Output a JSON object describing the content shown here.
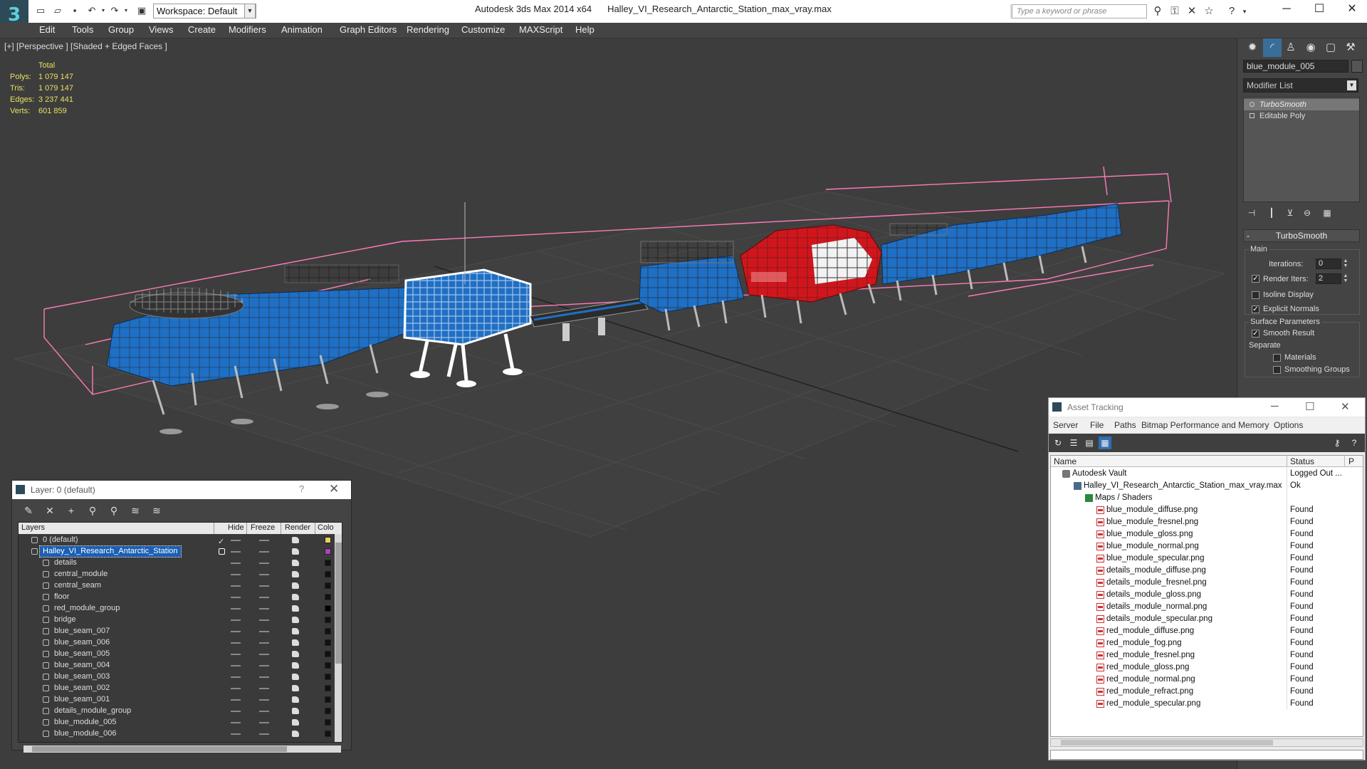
{
  "window": {
    "app_title": "Autodesk 3ds Max  2014 x64",
    "doc_title": "Halley_VI_Research_Antarctic_Station_max_vray.max",
    "workspace": "Workspace: Default",
    "search_placeholder": "Type a keyword or phrase",
    "logo_glyph": "3"
  },
  "menu": [
    "Edit",
    "Tools",
    "Group",
    "Views",
    "Create",
    "Modifiers",
    "Animation",
    "Graph Editors",
    "Rendering",
    "Customize",
    "MAXScript",
    "Help"
  ],
  "viewport": {
    "label": "[+] [Perspective ] [Shaded + Edged Faces ]",
    "stats": {
      "header": "Total",
      "rows": [
        {
          "label": "Polys:",
          "value": "1 079 147"
        },
        {
          "label": "Tris:",
          "value": "1 079 147"
        },
        {
          "label": "Edges:",
          "value": "3 237 441"
        },
        {
          "label": "Verts:",
          "value": "601 859"
        }
      ]
    },
    "colors": {
      "blue": "#1f6fc4",
      "red": "#d0161c",
      "white": "#ffffff",
      "pink": "#ff7ab8",
      "grid": "#4a4a4a"
    }
  },
  "modify_panel": {
    "object_name": "blue_module_005",
    "modifier_list": "Modifier List",
    "stack": [
      "TurboSmooth",
      "Editable Poly"
    ],
    "rollout_title": "TurboSmooth",
    "main_group": "Main",
    "iterations_label": "Iterations:",
    "iterations_value": "0",
    "render_iters_label": "Render Iters:",
    "render_iters_value": "2",
    "isoline_label": "Isoline Display",
    "explicit_label": "Explicit Normals",
    "surface_group": "Surface Parameters",
    "smooth_label": "Smooth Result",
    "separate_label": "Separate",
    "materials_label": "Materials",
    "smoothing_label": "Smoothing Groups"
  },
  "layer_window": {
    "title": "Layer: 0 (default)",
    "help": "?",
    "columns": [
      "Layers",
      "Hide",
      "Freeze",
      "Render",
      "Colo"
    ],
    "rows": [
      {
        "name": "0 (default)",
        "indent": 1,
        "color": "#e8d060",
        "check": "✓"
      },
      {
        "name": "Halley_VI_Research_Antarctic_Station",
        "indent": 1,
        "color": "#b040c0",
        "selected": true
      },
      {
        "name": "details",
        "indent": 2,
        "color": "#111111"
      },
      {
        "name": "central_module",
        "indent": 2,
        "color": "#111111"
      },
      {
        "name": "central_seam",
        "indent": 2,
        "color": "#111111"
      },
      {
        "name": "floor",
        "indent": 2,
        "color": "#111111"
      },
      {
        "name": "red_module_group",
        "indent": 2,
        "color": "#000000"
      },
      {
        "name": "bridge",
        "indent": 2,
        "color": "#111111"
      },
      {
        "name": "blue_seam_007",
        "indent": 2,
        "color": "#111111"
      },
      {
        "name": "blue_seam_006",
        "indent": 2,
        "color": "#111111"
      },
      {
        "name": "blue_seam_005",
        "indent": 2,
        "color": "#111111"
      },
      {
        "name": "blue_seam_004",
        "indent": 2,
        "color": "#111111"
      },
      {
        "name": "blue_seam_003",
        "indent": 2,
        "color": "#111111"
      },
      {
        "name": "blue_seam_002",
        "indent": 2,
        "color": "#111111"
      },
      {
        "name": "blue_seam_001",
        "indent": 2,
        "color": "#111111"
      },
      {
        "name": "details_module_group",
        "indent": 2,
        "color": "#111111"
      },
      {
        "name": "blue_module_005",
        "indent": 2,
        "color": "#111111"
      },
      {
        "name": "blue_module_006",
        "indent": 2,
        "color": "#111111"
      }
    ]
  },
  "asset_tracking": {
    "title": "Asset Tracking",
    "menu": [
      "Server",
      "File",
      "Paths",
      "Bitmap Performance and Memory",
      "Options"
    ],
    "columns": [
      "Name",
      "Status",
      "P"
    ],
    "rows": [
      {
        "name": "Autodesk Vault",
        "status": "Logged Out ...",
        "indent": 1,
        "icon": "vault"
      },
      {
        "name": "Halley_VI_Research_Antarctic_Station_max_vray.max",
        "status": "Ok",
        "indent": 2,
        "icon": "max"
      },
      {
        "name": "Maps / Shaders",
        "status": "",
        "indent": 3,
        "icon": "maps"
      },
      {
        "name": "blue_module_diffuse.png",
        "status": "Found",
        "indent": 4,
        "icon": "png"
      },
      {
        "name": "blue_module_fresnel.png",
        "status": "Found",
        "indent": 4,
        "icon": "png"
      },
      {
        "name": "blue_module_gloss.png",
        "status": "Found",
        "indent": 4,
        "icon": "png"
      },
      {
        "name": "blue_module_normal.png",
        "status": "Found",
        "indent": 4,
        "icon": "png"
      },
      {
        "name": "blue_module_specular.png",
        "status": "Found",
        "indent": 4,
        "icon": "png"
      },
      {
        "name": "details_module_diffuse.png",
        "status": "Found",
        "indent": 4,
        "icon": "png"
      },
      {
        "name": "details_module_fresnel.png",
        "status": "Found",
        "indent": 4,
        "icon": "png"
      },
      {
        "name": "details_module_gloss.png",
        "status": "Found",
        "indent": 4,
        "icon": "png"
      },
      {
        "name": "details_module_normal.png",
        "status": "Found",
        "indent": 4,
        "icon": "png"
      },
      {
        "name": "details_module_specular.png",
        "status": "Found",
        "indent": 4,
        "icon": "png"
      },
      {
        "name": "red_module_diffuse.png",
        "status": "Found",
        "indent": 4,
        "icon": "png"
      },
      {
        "name": "red_module_fog.png",
        "status": "Found",
        "indent": 4,
        "icon": "png"
      },
      {
        "name": "red_module_fresnel.png",
        "status": "Found",
        "indent": 4,
        "icon": "png"
      },
      {
        "name": "red_module_gloss.png",
        "status": "Found",
        "indent": 4,
        "icon": "png"
      },
      {
        "name": "red_module_normal.png",
        "status": "Found",
        "indent": 4,
        "icon": "png"
      },
      {
        "name": "red_module_refract.png",
        "status": "Found",
        "indent": 4,
        "icon": "png"
      },
      {
        "name": "red_module_specular.png",
        "status": "Found",
        "indent": 4,
        "icon": "png"
      }
    ]
  }
}
